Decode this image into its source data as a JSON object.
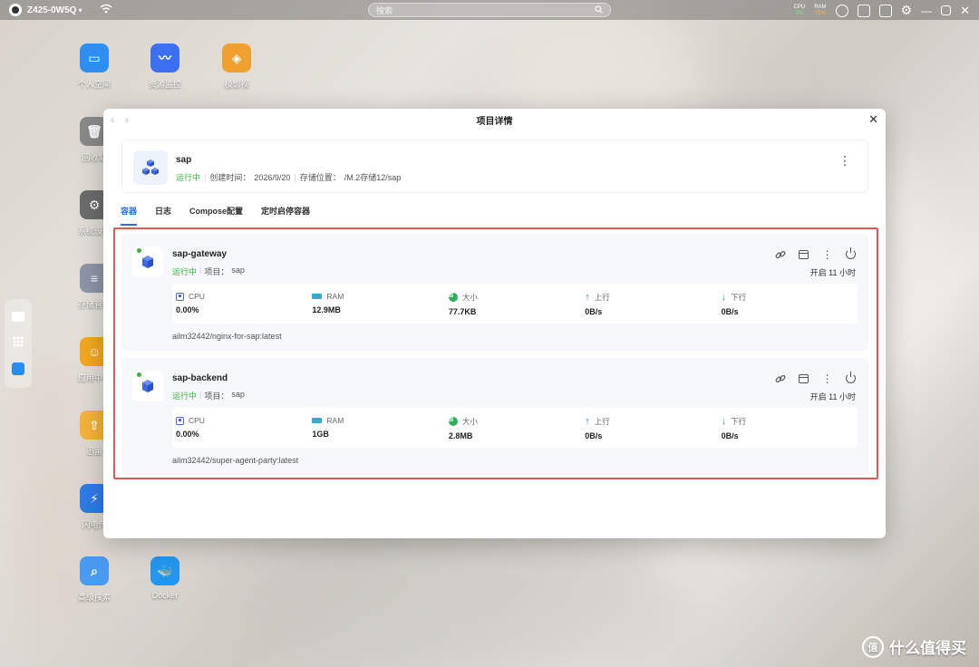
{
  "topbar": {
    "host": "Z425-0W5Q",
    "search_placeholder": "搜索",
    "cpu_label": "CPU",
    "cpu_value": "2%",
    "ram_label": "RAM",
    "ram_value": "75%"
  },
  "desktop_icons": [
    {
      "label": "个人空间",
      "color": "#2f8ff0"
    },
    {
      "label": "资源监控",
      "color": "#3d6ff2"
    },
    {
      "label": "极影视",
      "color": "#f0a030"
    },
    {
      "label": "回收站",
      "color": "#8a8a8a"
    },
    {
      "label": "系统设置",
      "color": "#6c6c6c"
    },
    {
      "label": "存储管理",
      "color": "#8e96a8"
    },
    {
      "label": "应用中心",
      "color": "#f4a81f"
    },
    {
      "label": "迅雷",
      "color": "#f5b43a"
    },
    {
      "label": "闪电传",
      "color": "#2f7be8"
    },
    {
      "label": "高级搜索",
      "color": "#4a9af0"
    },
    {
      "label": "Docker",
      "color": "#2496ed"
    }
  ],
  "window": {
    "title": "项目详情",
    "project": {
      "name": "sap",
      "status": "运行中",
      "created_label": "创建时间：",
      "created": "2026/9/20",
      "storage_label": "存储位置：",
      "storage": "/M.2存储12/sap"
    },
    "tabs": [
      "容器",
      "日志",
      "Compose配置",
      "定时启停容器"
    ],
    "containers": [
      {
        "name": "sap-gateway",
        "status": "运行中",
        "project_label": "项目：",
        "project": "sap",
        "uptime": "开启 11 小时",
        "stats": {
          "cpu_label": "CPU",
          "cpu": "0.00%",
          "ram_label": "RAM",
          "ram": "12.9MB",
          "size_label": "大小",
          "size": "77.7KB",
          "up_label": "上行",
          "up": "0B/s",
          "down_label": "下行",
          "down": "0B/s"
        },
        "image": "ailm32442/nginx-for-sap:latest"
      },
      {
        "name": "sap-backend",
        "status": "运行中",
        "project_label": "项目：",
        "project": "sap",
        "uptime": "开启 11 小时",
        "stats": {
          "cpu_label": "CPU",
          "cpu": "0.00%",
          "ram_label": "RAM",
          "ram": "1GB",
          "size_label": "大小",
          "size": "2.8MB",
          "up_label": "上行",
          "up": "0B/s",
          "down_label": "下行",
          "down": "0B/s"
        },
        "image": "ailm32442/super-agent-party:latest"
      }
    ]
  },
  "watermark": {
    "badge": "值",
    "text": "什么值得买"
  }
}
